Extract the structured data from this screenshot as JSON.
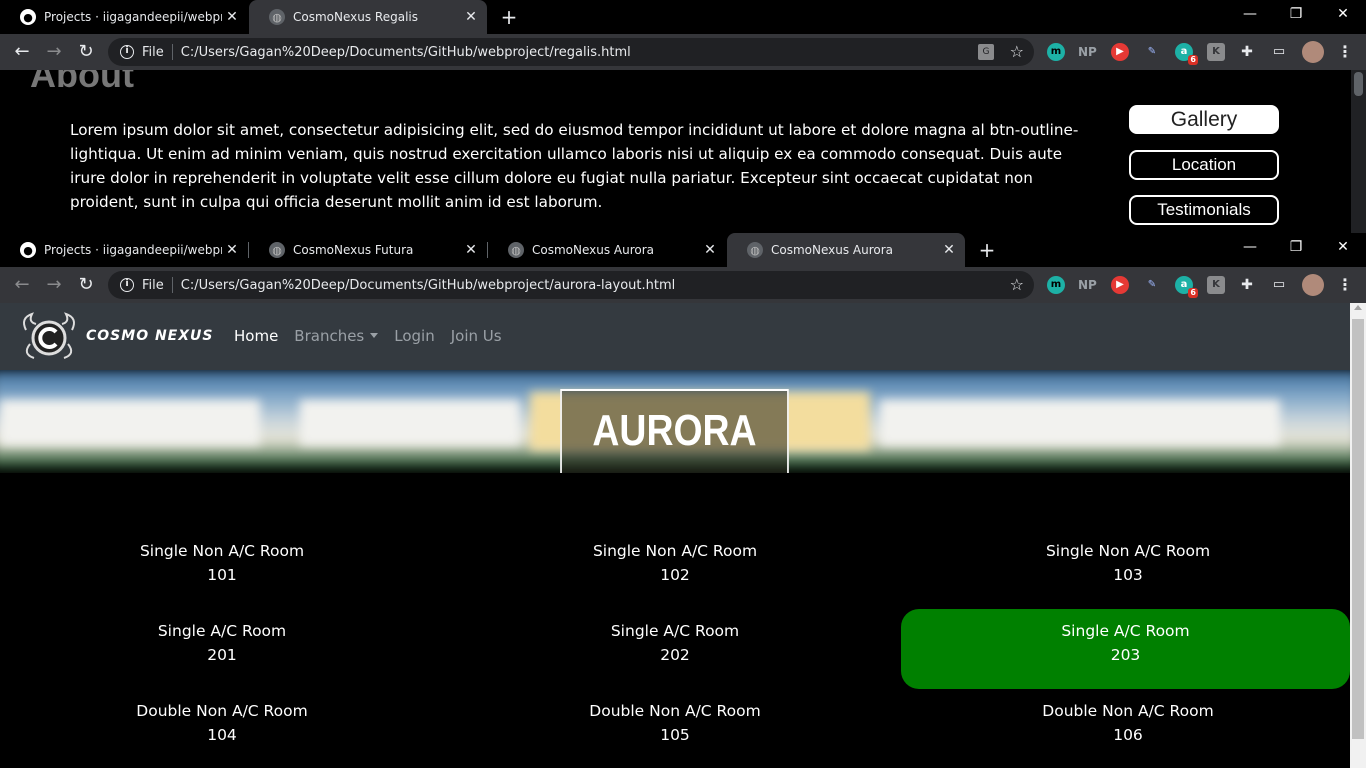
{
  "top_window": {
    "tabs": [
      {
        "label": "Projects · iigagandeepii/webproje",
        "favicon": "github-icon"
      },
      {
        "label": "CosmoNexus Regalis",
        "favicon": "globe-icon"
      }
    ],
    "file_label": "File",
    "url": "C:/Users/Gagan%20Deep/Documents/GitHub/webproject/regalis.html"
  },
  "regalis": {
    "section_title": "About",
    "about_text": "Lorem ipsum dolor sit amet, consectetur adipisicing elit, sed do eiusmod tempor incididunt ut labore et dolore magna al btn-outline-lightiqua. Ut enim ad minim veniam, quis nostrud exercitation ullamco laboris nisi ut aliquip ex ea commodo consequat. Duis aute irure dolor in reprehenderit in voluptate velit esse cillum dolore eu fugiat nulla pariatur. Excepteur sint occaecat cupidatat non proident, sunt in culpa qui officia deserunt mollit anim id est laborum.",
    "buttons": [
      "Gallery",
      "Location",
      "Testimonials"
    ]
  },
  "bottom_window": {
    "tabs": [
      {
        "label": "Projects · iigagandeepii/webproje",
        "favicon": "github-icon"
      },
      {
        "label": "CosmoNexus Futura",
        "favicon": "globe-icon"
      },
      {
        "label": "CosmoNexus Aurora",
        "favicon": "globe-icon"
      },
      {
        "label": "CosmoNexus Aurora",
        "favicon": "globe-icon"
      }
    ],
    "file_label": "File",
    "url": "C:/Users/Gagan%20Deep/Documents/GitHub/webproject/aurora-layout.html"
  },
  "extensions": {
    "np_label": "NP",
    "m_label": "m",
    "badge_count": "6"
  },
  "aurora": {
    "brand": "COSMO NEXUS",
    "nav": {
      "home": "Home",
      "branches": "Branches",
      "login": "Login",
      "join": "Join Us"
    },
    "hero_title": "AURORA",
    "rooms": [
      {
        "type": "Single Non A/C Room",
        "number": "101",
        "selected": false
      },
      {
        "type": "Single Non A/C Room",
        "number": "102",
        "selected": false
      },
      {
        "type": "Single Non A/C Room",
        "number": "103",
        "selected": false
      },
      {
        "type": "Single A/C Room",
        "number": "201",
        "selected": false
      },
      {
        "type": "Single A/C Room",
        "number": "202",
        "selected": false
      },
      {
        "type": "Single A/C Room",
        "number": "203",
        "selected": true
      },
      {
        "type": "Double Non A/C Room",
        "number": "104",
        "selected": false
      },
      {
        "type": "Double Non A/C Room",
        "number": "105",
        "selected": false
      },
      {
        "type": "Double Non A/C Room",
        "number": "106",
        "selected": false
      }
    ]
  },
  "colors": {
    "chrome_dark": "#35363a",
    "omnibox": "#202124",
    "navbar": "#343a40",
    "selected_room": "#008000"
  }
}
